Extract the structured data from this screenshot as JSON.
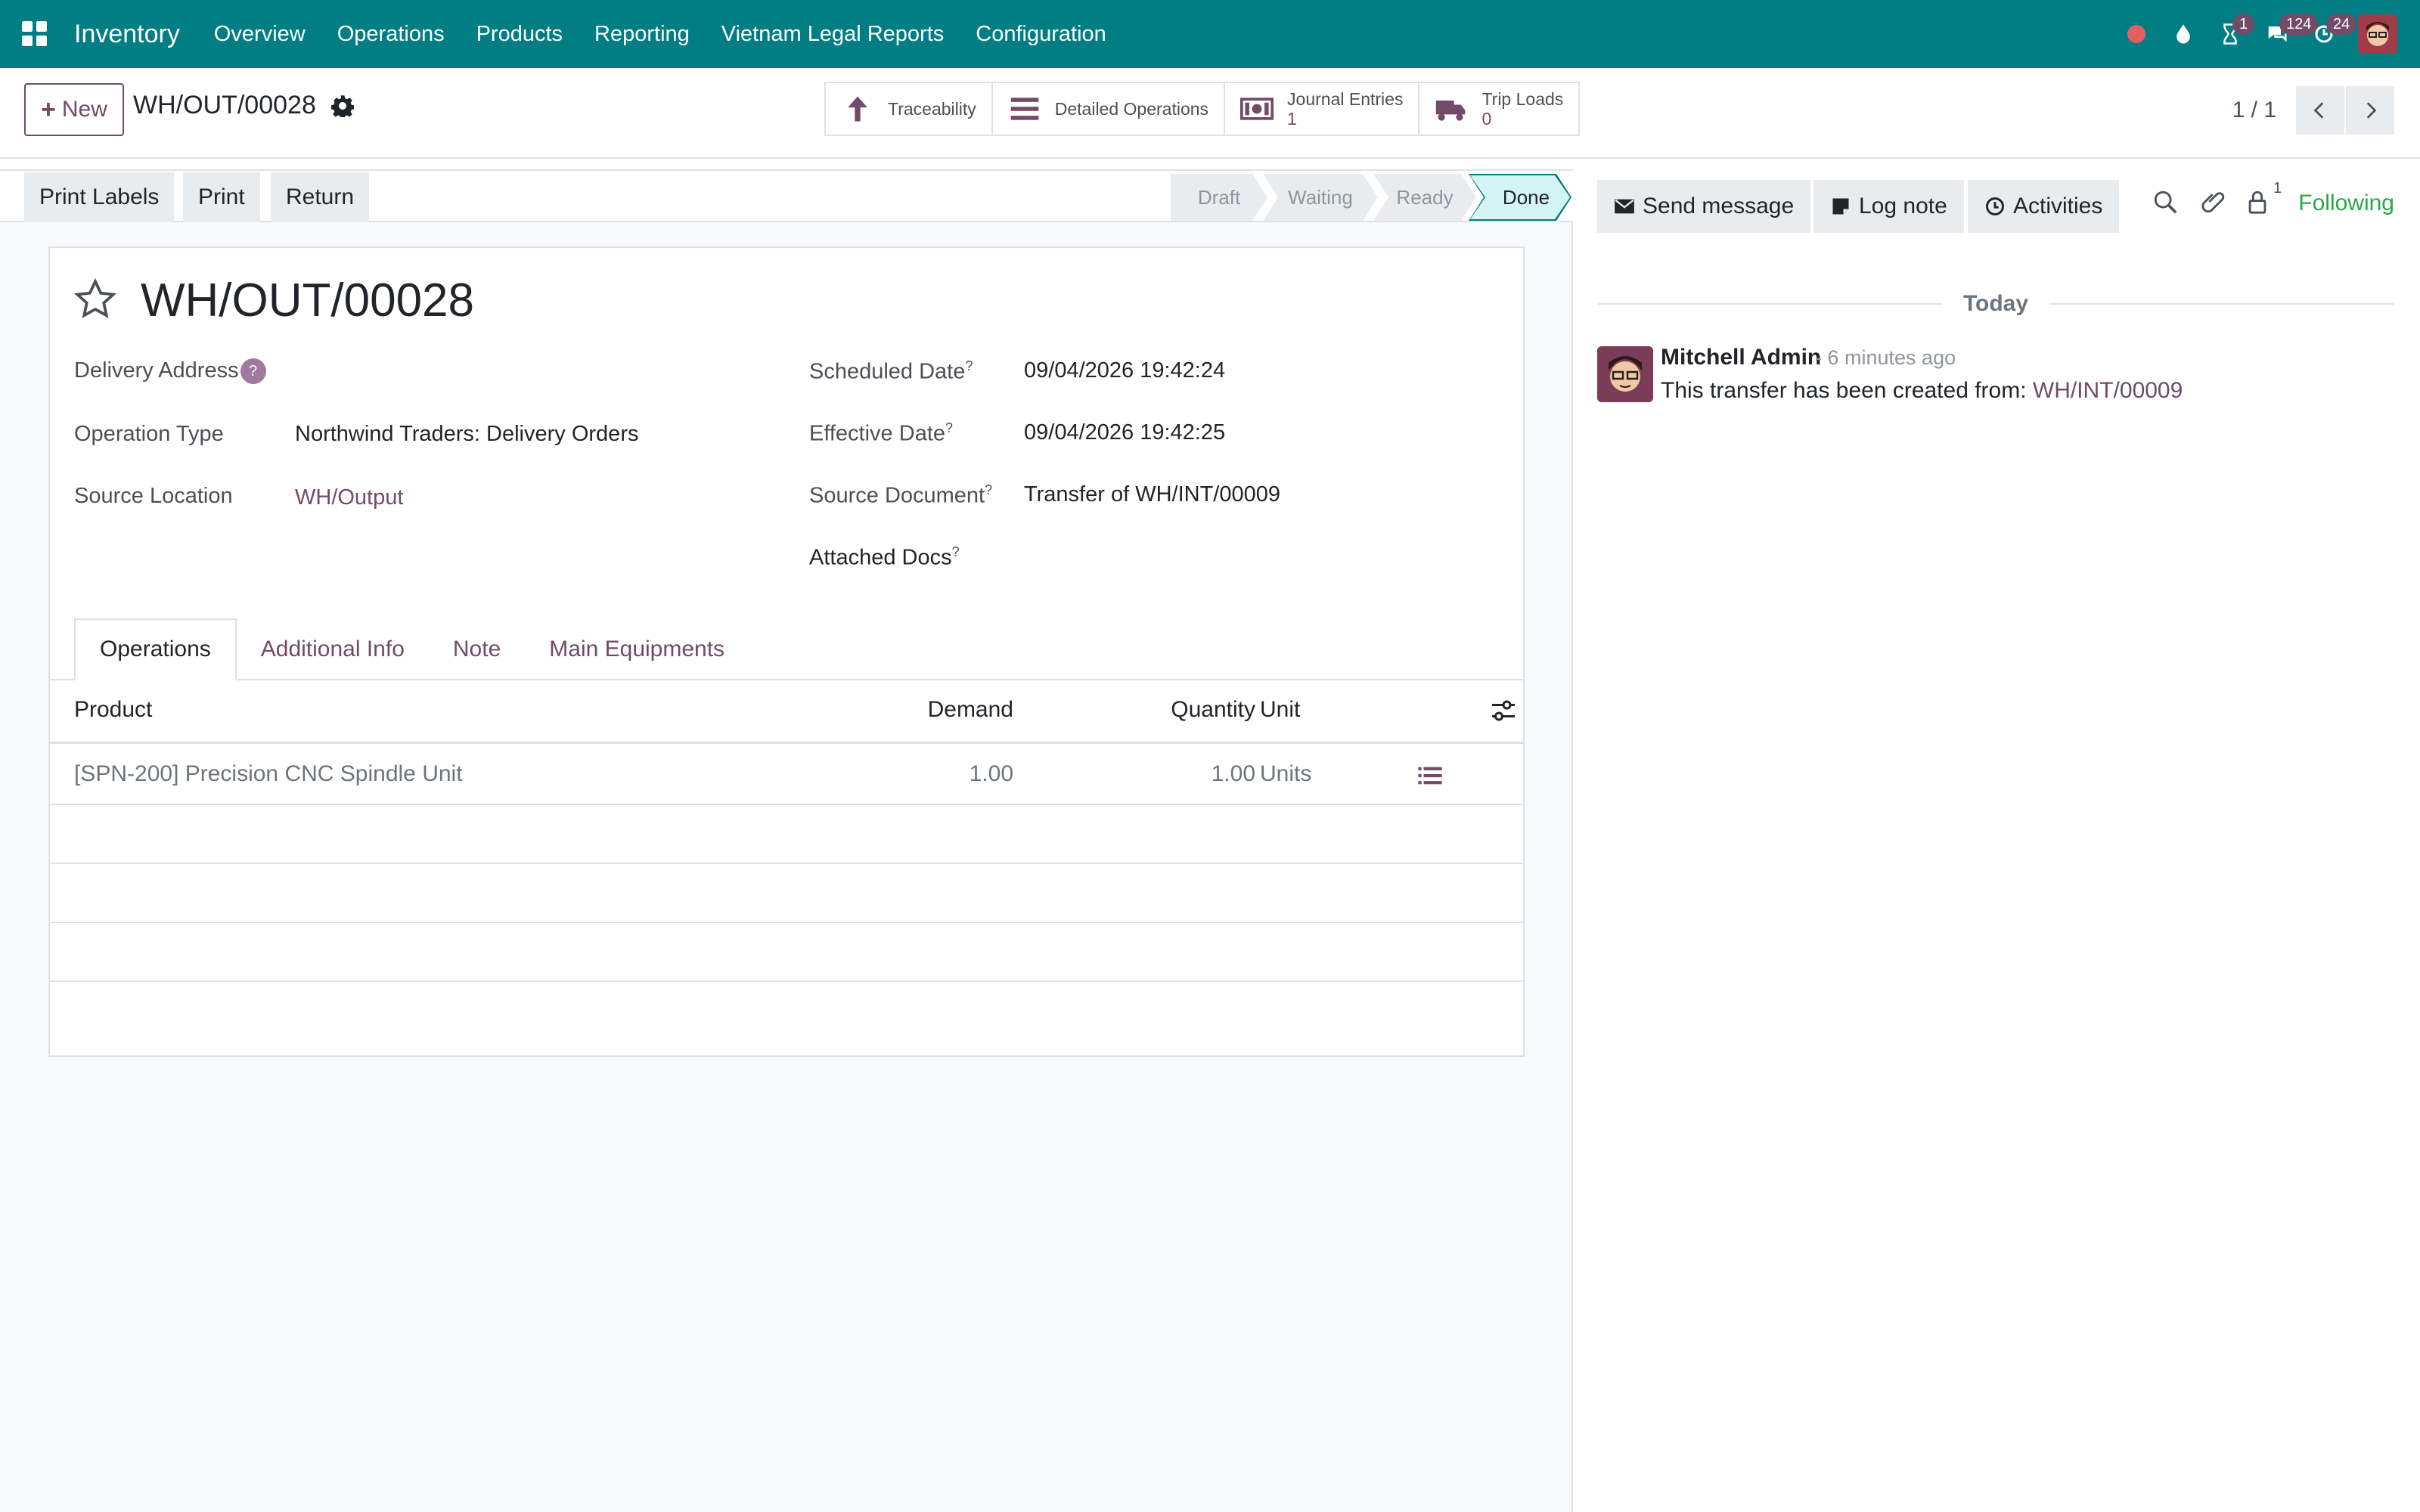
{
  "navbar": {
    "app_name": "Inventory",
    "menu": [
      "Overview",
      "Operations",
      "Products",
      "Reporting",
      "Vietnam Legal Reports",
      "Configuration"
    ],
    "badges": {
      "activities": "1",
      "messages": "124",
      "updates": "24"
    }
  },
  "control": {
    "new_label": "New",
    "breadcrumb": "WH/OUT/00028",
    "smart_buttons": {
      "traceability": "Traceability",
      "detailed_operations": "Detailed Operations",
      "journal_entries": {
        "label": "Journal Entries",
        "value": "1"
      },
      "trip_loads": {
        "label": "Trip Loads",
        "value": "0"
      }
    },
    "pager": "1 / 1"
  },
  "statusbar": {
    "buttons": [
      "Print Labels",
      "Print",
      "Return"
    ],
    "stages": [
      "Draft",
      "Waiting",
      "Ready",
      "Done"
    ],
    "current_stage": "Done"
  },
  "form": {
    "title": "WH/OUT/00028",
    "labels": {
      "delivery_address": "Delivery Address",
      "operation_type": "Operation Type",
      "source_location": "Source Location",
      "scheduled_date": "Scheduled Date",
      "effective_date": "Effective Date",
      "source_document": "Source Document",
      "attached_docs": "Attached Docs"
    },
    "values": {
      "operation_type": "Northwind Traders: Delivery Orders",
      "source_location": "WH/Output",
      "scheduled_date": "09/04/2026 19:42:24",
      "effective_date": "09/04/2026 19:42:25",
      "source_document": "Transfer of WH/INT/00009"
    },
    "help_mark": "?",
    "tabs": [
      "Operations",
      "Additional Info",
      "Note",
      "Main Equipments"
    ],
    "table": {
      "headers": [
        "Product",
        "Demand",
        "Quantity",
        "Unit"
      ],
      "rows": [
        {
          "product": "[SPN-200] Precision CNC Spindle Unit",
          "demand": "1.00",
          "quantity": "1.00",
          "unit": "Units"
        }
      ]
    }
  },
  "chatter": {
    "send_message": "Send message",
    "log_note": "Log note",
    "activities": "Activities",
    "followers_count": "1",
    "following": "Following",
    "today": "Today",
    "message": {
      "author": "Mitchell Admin",
      "time": "- 6 minutes ago",
      "body": "This transfer has been created from: ",
      "link": "WH/INT/00009"
    }
  },
  "colors": {
    "navbar": "#017e84",
    "brand_purple": "#714b67",
    "following_green": "#28a745",
    "done_stage": "#d5f4f6"
  }
}
